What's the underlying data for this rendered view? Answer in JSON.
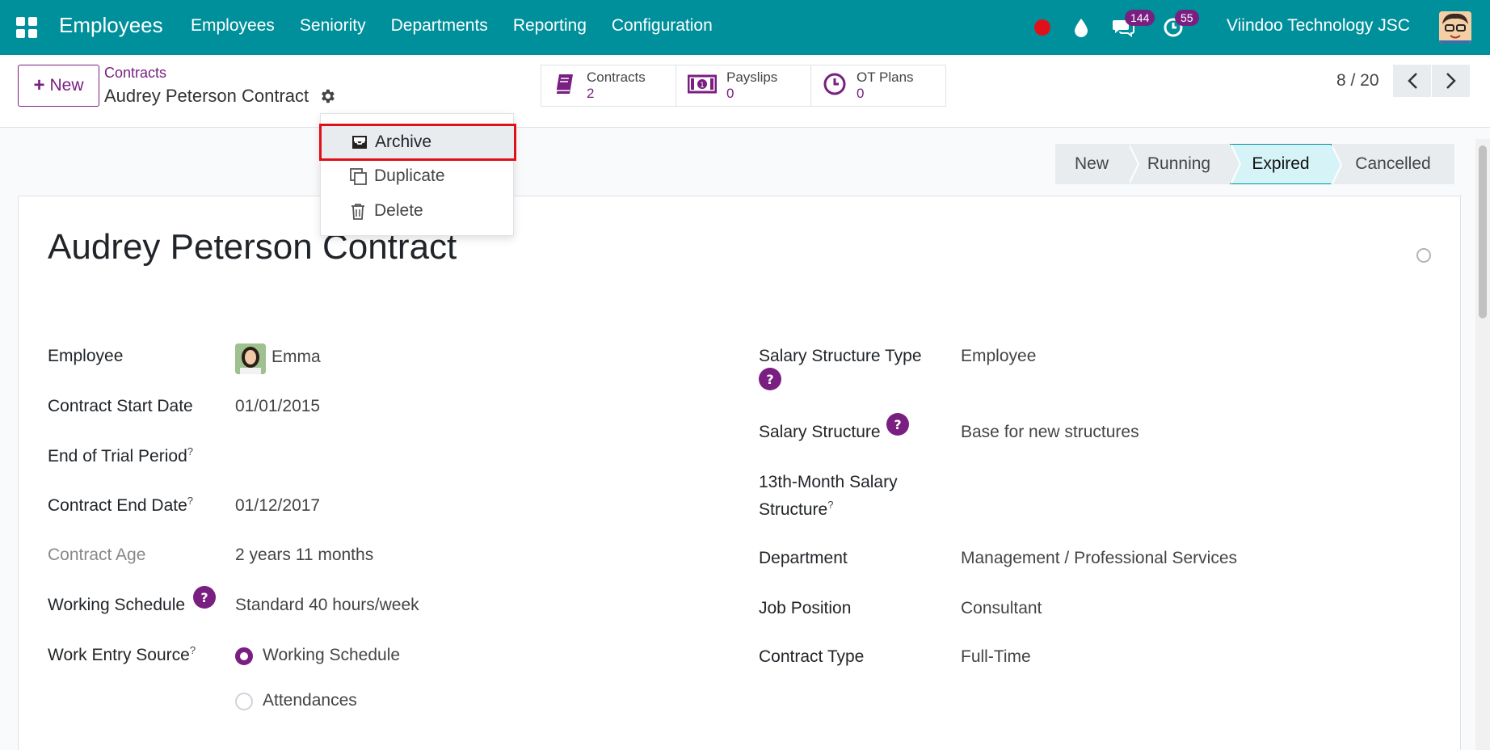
{
  "navbar": {
    "brand": "Employees",
    "menu": [
      "Employees",
      "Seniority",
      "Departments",
      "Reporting",
      "Configuration"
    ],
    "messages_badge": "144",
    "activities_badge": "55",
    "company": "Viindoo Technology JSC"
  },
  "control": {
    "new_label": "New",
    "breadcrumb_parent": "Contracts",
    "record_title": "Audrey Peterson Contract",
    "smart_buttons": [
      {
        "label": "Contracts",
        "value": "2"
      },
      {
        "label": "Payslips",
        "value": "0"
      },
      {
        "label": "OT Plans",
        "value": "0"
      }
    ],
    "pager": "8 / 20"
  },
  "action_menu": {
    "items": [
      "Archive",
      "Duplicate",
      "Delete"
    ]
  },
  "status": {
    "stages": [
      "New",
      "Running",
      "Expired",
      "Cancelled"
    ],
    "active": "Expired"
  },
  "form": {
    "title": "Audrey Peterson Contract",
    "left": {
      "employee_label": "Employee",
      "employee_value": "Emma",
      "start_label": "Contract Start Date",
      "start_value": "01/01/2015",
      "trial_label": "End of Trial Period",
      "end_label": "Contract End Date",
      "end_value": "01/12/2017",
      "age_label": "Contract Age",
      "age_value": "2 years 11 months",
      "schedule_label": "Working Schedule",
      "schedule_value": "Standard 40 hours/week",
      "source_label": "Work Entry Source",
      "source_options": [
        "Working Schedule",
        "Attendances"
      ]
    },
    "right": {
      "sst_label": "Salary Structure Type",
      "sst_value": "Employee",
      "ss_label": "Salary Structure",
      "ss_value": "Base for new structures",
      "thirteen_label_1": "13th-Month Salary",
      "thirteen_label_2": "Structure",
      "dept_label": "Department",
      "dept_value": "Management / Professional Services",
      "job_label": "Job Position",
      "job_value": "Consultant",
      "type_label": "Contract Type",
      "type_value": "Full-Time"
    },
    "help_glyph": "?",
    "sup_glyph": "?"
  },
  "colors": {
    "navbar": "#00909b",
    "primary": "#7a1f82",
    "highlight": "#e0101a"
  }
}
